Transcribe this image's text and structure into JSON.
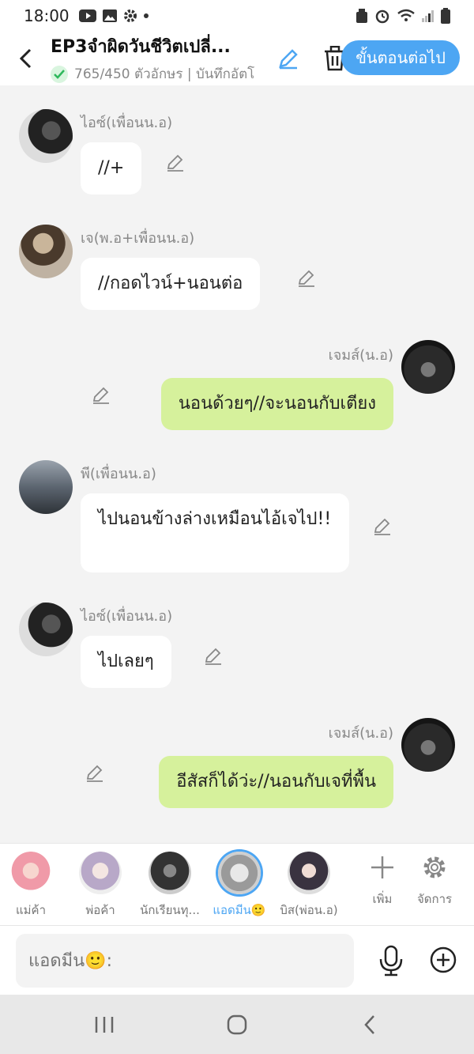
{
  "status": {
    "time": "18:00"
  },
  "header": {
    "title": "EP3จำผิดวันชีวิตเปลี่...",
    "subtitle": "765/450 ตัวอักษร | บันทึกอัตโ",
    "next_label": "ขั้นตอนต่อไป"
  },
  "messages": [
    {
      "name": "ไอซ์(เพื่อนน.อ)",
      "text": "//+",
      "side": "left"
    },
    {
      "name": "เจ(พ.อ+เพื่อนน.อ)",
      "text": "//กอดไวน์+นอนต่อ",
      "side": "left"
    },
    {
      "name": "เจมส์(น.อ)",
      "text": "นอนด้วยๆ//จะนอนกับเตียง",
      "side": "right"
    },
    {
      "name": "พี(เพื่อนน.อ)",
      "text": "ไปนอนข้างล่างเหมือนไอ้เจไป!!",
      "side": "left"
    },
    {
      "name": "ไอซ์(เพื่อนน.อ)",
      "text": "ไปเลยๆ",
      "side": "left"
    },
    {
      "name": "เจมส์(น.อ)",
      "text": "อีสัสก็ได้ว่ะ//นอนกับเจที่พื้น",
      "side": "right"
    }
  ],
  "characters": [
    {
      "label": "แม่ค้า"
    },
    {
      "label": "พ่อค้า"
    },
    {
      "label": "นักเรียนทุ..."
    },
    {
      "label": "แอดมีน🙂"
    },
    {
      "label": "บิส(พ่อน.อ)"
    }
  ],
  "tools": {
    "add_label": "เพิ่ม",
    "manage_label": "จัดการ"
  },
  "input": {
    "placeholder": "แอดมีน🙂:"
  },
  "colors": {
    "accent": "#4da6f3",
    "bubble_right": "#d6f19c",
    "background": "#f3f3f3"
  }
}
